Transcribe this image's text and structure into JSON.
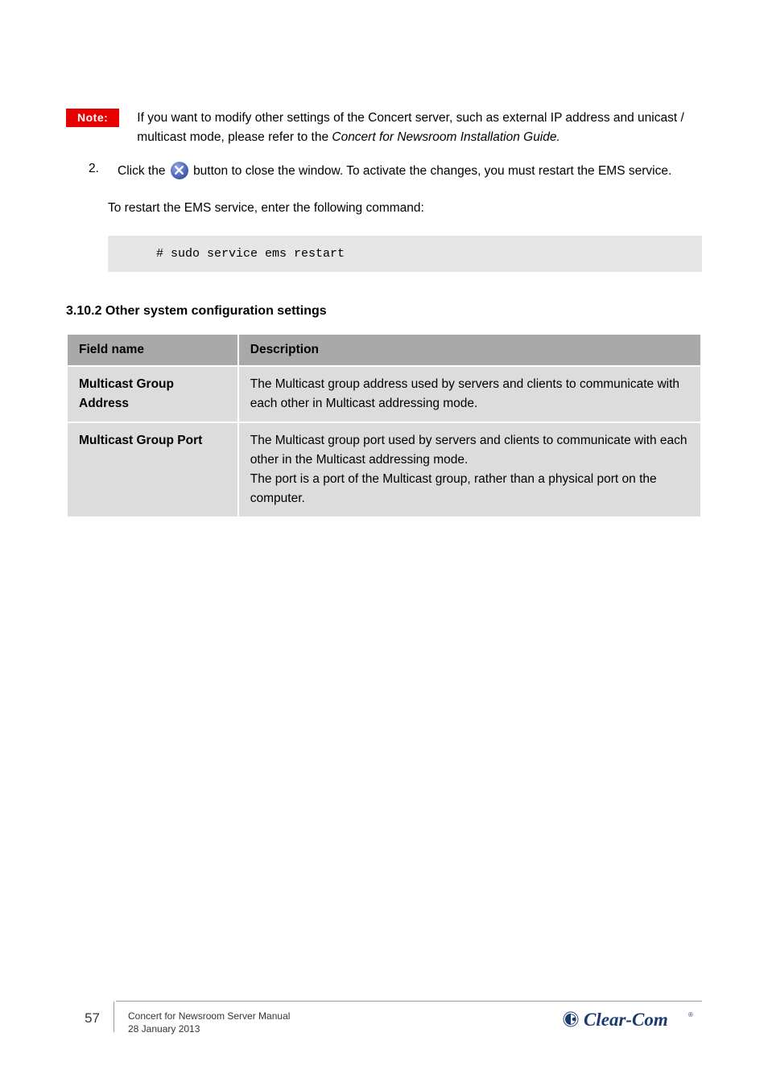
{
  "note": {
    "label": "Note:",
    "text": "If you want to modify other settings of the Concert server, such as external IP address and unicast / multicast mode, please refer to the Concert for Newsroom Installation Guide.",
    "emphasis_phrases": [
      "Concert for Newsroom Installation Guide"
    ]
  },
  "step": {
    "number": "2.",
    "text_before_icon": "Click the ",
    "icon_name": "close-window-icon",
    "text_after_icon": " button to close the window. To activate the changes, you must restart the EMS service."
  },
  "restart_para": "To restart the EMS service, enter the following command:",
  "code": "# sudo service ems restart",
  "section_title": "3.10.2 Other system configuration settings",
  "table": {
    "headers": [
      "Field name",
      "Description"
    ],
    "rows": [
      {
        "field": "Multicast Group Address",
        "desc": "The Multicast group address used by servers and clients to communicate with each other in Multicast addressing mode."
      },
      {
        "field": "Multicast Group Port",
        "desc": "The Multicast group port used by servers and clients to communicate with each other in the Multicast addressing mode.\nThe port is a port of the Multicast group, rather than a physical port on the computer."
      }
    ]
  },
  "footer": {
    "page": "57",
    "line1": "Concert for Newsroom Server Manual",
    "line2": "28 January 2013",
    "logo_text": "Clear-Com"
  }
}
